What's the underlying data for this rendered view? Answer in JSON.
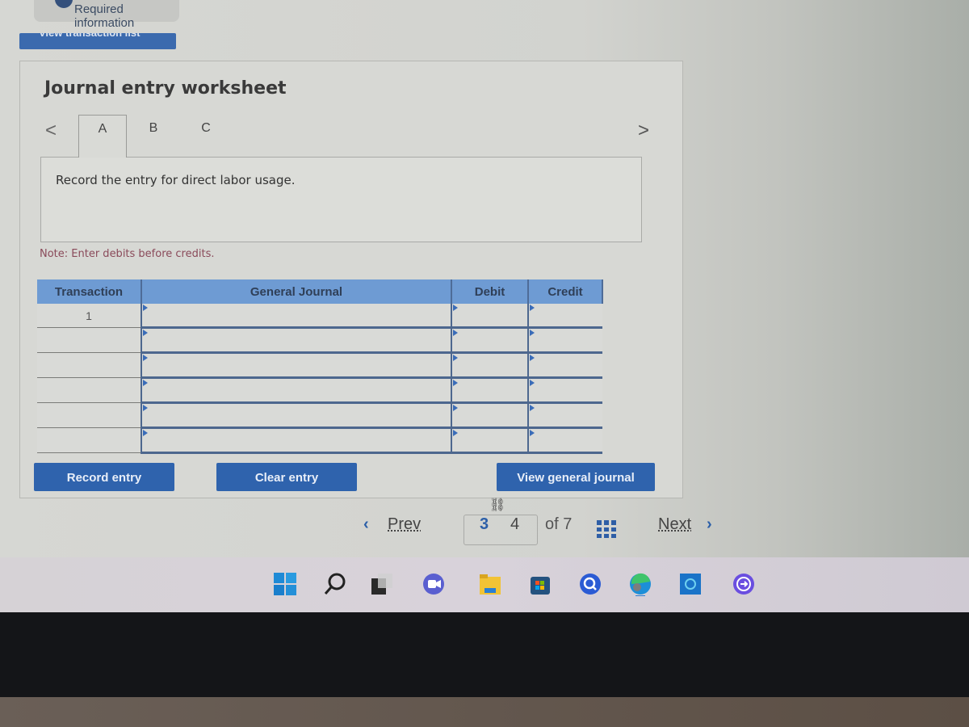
{
  "header": {
    "required_info_label": "Required information",
    "view_transaction_list_label": "View transaction list"
  },
  "worksheet": {
    "title": "Journal entry worksheet",
    "tabs": [
      {
        "label": "A",
        "active": true
      },
      {
        "label": "B",
        "active": false
      },
      {
        "label": "C",
        "active": false
      }
    ],
    "prev_tab_icon": "<",
    "next_tab_icon": ">",
    "question_text": "Record the entry for direct labor usage.",
    "note": "Note: Enter debits before credits."
  },
  "journal_table": {
    "columns": [
      "Transaction",
      "General Journal",
      "Debit",
      "Credit"
    ],
    "rows": [
      {
        "transaction": "1",
        "account": "",
        "debit": "",
        "credit": ""
      },
      {
        "transaction": "",
        "account": "",
        "debit": "",
        "credit": ""
      },
      {
        "transaction": "",
        "account": "",
        "debit": "",
        "credit": ""
      },
      {
        "transaction": "",
        "account": "",
        "debit": "",
        "credit": ""
      },
      {
        "transaction": "",
        "account": "",
        "debit": "",
        "credit": ""
      },
      {
        "transaction": "",
        "account": "",
        "debit": "",
        "credit": ""
      }
    ]
  },
  "buttons": {
    "record_entry": "Record entry",
    "clear_entry": "Clear entry",
    "view_general_journal": "View general journal"
  },
  "pagination": {
    "prev_label": "Prev",
    "next_label": "Next",
    "pages_linked": [
      "3",
      "4"
    ],
    "current_page": "3",
    "of_total": "of 7",
    "prev_icon": "‹",
    "next_icon": "›"
  },
  "taskbar": {
    "icons": [
      "windows-start",
      "search",
      "task-view",
      "teams-meet",
      "file-explorer",
      "microsoft-store",
      "quick-assist",
      "edge",
      "alexa",
      "phone-link"
    ]
  },
  "colors": {
    "accent_blue": "#2f63ad",
    "header_blue": "#6e9bd3",
    "note_red": "#8a4a5a"
  }
}
